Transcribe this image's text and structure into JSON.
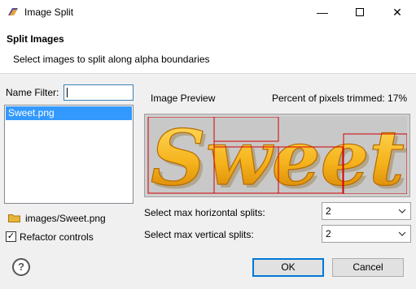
{
  "window": {
    "title": "Image Split"
  },
  "header": {
    "title": "Split Images",
    "description": "Select images to split along alpha boundaries"
  },
  "filter": {
    "label": "Name Filter:",
    "value": ""
  },
  "files": [
    "Sweet.png"
  ],
  "preview": {
    "label": "Image Preview",
    "trim_label": "Percent of pixels trimmed: 17%",
    "image_text": "Sweet"
  },
  "path": "images/Sweet.png",
  "refactor": {
    "label": "Refactor controls",
    "checked": true,
    "check_glyph": "✓"
  },
  "h_splits": {
    "label": "Select max horizontal splits:",
    "value": "2"
  },
  "v_splits": {
    "label": "Select max vertical splits:",
    "value": "2"
  },
  "buttons": {
    "ok": "OK",
    "cancel": "Cancel"
  },
  "icons": {
    "help": "?",
    "minimize": "—",
    "close": "✕"
  },
  "colors": {
    "selection": "#3399ff",
    "trim_box": "#d40000",
    "text_gold": "#f5b31c"
  }
}
